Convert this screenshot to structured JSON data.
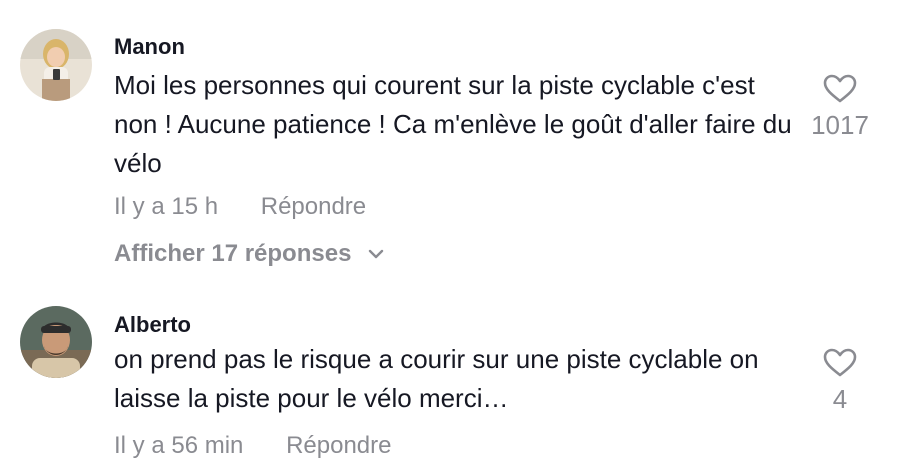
{
  "comments": [
    {
      "username": "Manon",
      "text": "Moi les personnes qui courent sur la piste cyclable c'est non ! Aucune patience ! Ca m'enlève le goût d'aller faire du vélo",
      "time": "Il y a 15 h",
      "reply_label": "Répondre",
      "likes": "1017",
      "show_replies_label": "Afficher 17 réponses",
      "avatar_icon": "user-avatar"
    },
    {
      "username": "Alberto",
      "text": "on prend pas le risque a courir sur une piste cyclable on laisse la piste pour le vélo merci…",
      "time": "Il y a 56 min",
      "reply_label": "Répondre",
      "likes": "4",
      "avatar_icon": "user-avatar"
    }
  ],
  "colors": {
    "primary_text": "#161823",
    "secondary_text": "#8a8b91",
    "background": "#ffffff"
  },
  "icons": {
    "like": "heart-outline-icon",
    "expand": "chevron-down-icon"
  }
}
